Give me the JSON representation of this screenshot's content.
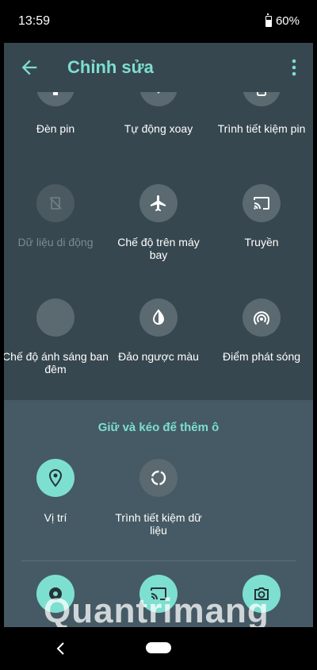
{
  "status": {
    "time": "13:59",
    "battery": "60%"
  },
  "app_bar": {
    "title": "Chỉnh sửa"
  },
  "active_tiles": [
    {
      "label": "Đèn pin",
      "icon": "flashlight-icon"
    },
    {
      "label": "Tự động xoay",
      "icon": "auto-rotate-icon"
    },
    {
      "label": "Trình tiết kiệm pin",
      "icon": "battery-saver-icon"
    },
    {
      "label": "Dữ liệu di động",
      "icon": "mobile-data-off-icon",
      "disabled": true
    },
    {
      "label": "Chế độ trên máy bay",
      "icon": "airplane-icon"
    },
    {
      "label": "Truyền",
      "icon": "cast-icon"
    },
    {
      "label": "Chế độ ánh sáng ban đêm",
      "icon": "night-light-icon"
    },
    {
      "label": "Đảo ngược màu",
      "icon": "invert-colors-icon"
    },
    {
      "label": "Điểm phát sóng",
      "icon": "hotspot-icon"
    }
  ],
  "add_section": {
    "title": "Giữ và kéo để thêm ô",
    "tiles": [
      {
        "label": "Vị trí",
        "icon": "location-icon"
      },
      {
        "label": "Trình tiết kiệm dữ liệu",
        "icon": "data-saver-icon"
      }
    ],
    "bottom_icons": [
      "settings-icon",
      "screen-cast-icon",
      "camera-icon"
    ]
  },
  "watermark": "Quantrimang",
  "colors": {
    "accent": "#7ddfd0",
    "panel": "#37474f",
    "add_panel": "#455a64"
  }
}
